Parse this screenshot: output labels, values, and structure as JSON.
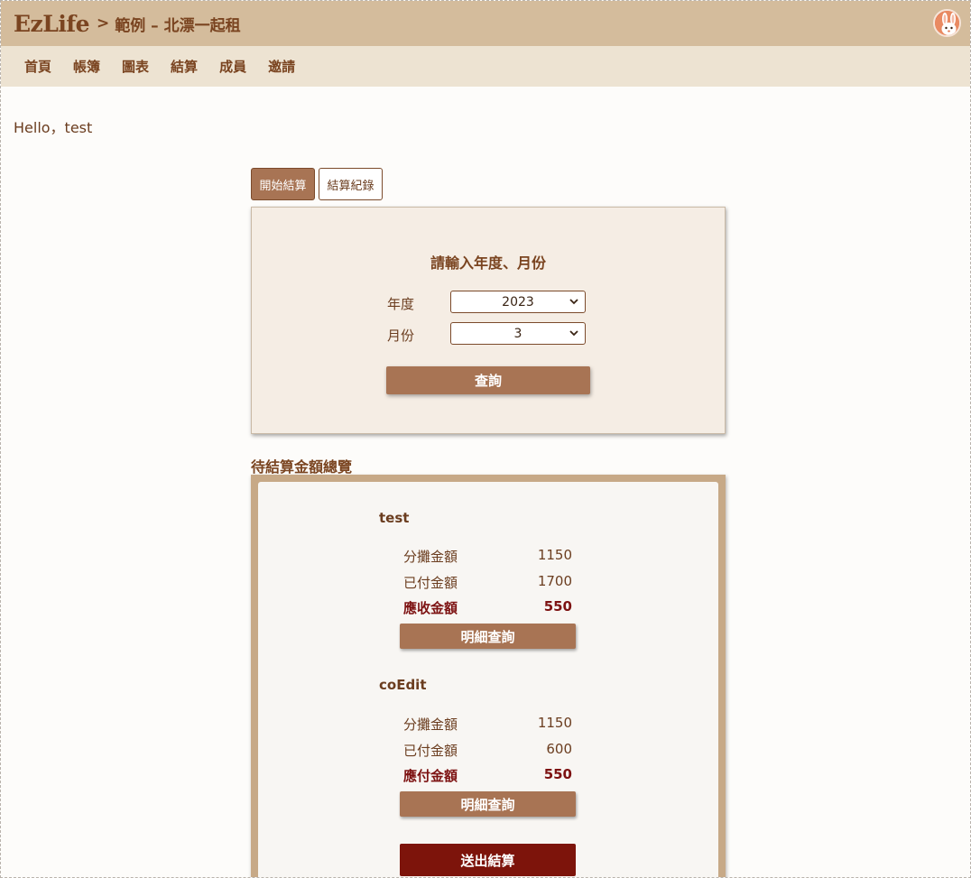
{
  "header": {
    "logo": "EzLife",
    "separator": ">",
    "book_title": "範例 – 北漂一起租"
  },
  "nav": {
    "items": [
      "首頁",
      "帳簿",
      "圖表",
      "結算",
      "成員",
      "邀請"
    ]
  },
  "greeting": "Hello，test",
  "tabs": {
    "start": "開始結算",
    "history": "結算紀錄"
  },
  "query": {
    "title": "請輸入年度、月份",
    "year_label": "年度",
    "year_value": "2023",
    "month_label": "月份",
    "month_value": "3",
    "submit": "查詢"
  },
  "summary": {
    "title": "待結算金額總覽",
    "members": [
      {
        "name": "test",
        "share_label": "分攤金額",
        "share": "1150",
        "paid_label": "已付金額",
        "paid": "1700",
        "net_label": "應收金額",
        "net": "550",
        "detail": "明細查詢"
      },
      {
        "name": "coEdit",
        "share_label": "分攤金額",
        "share": "1150",
        "paid_label": "已付金額",
        "paid": "600",
        "net_label": "應付金額",
        "net": "550",
        "detail": "明細查詢"
      }
    ],
    "submit": "送出結算"
  },
  "colors": {
    "header_bg": "#d4bc9c",
    "nav_bg": "#ede3d2",
    "accent": "#a87454",
    "danger": "#7d140b"
  },
  "icons": {
    "avatar": "rabbit-avatar-icon",
    "select_chevron": "chevron-down-icon"
  }
}
